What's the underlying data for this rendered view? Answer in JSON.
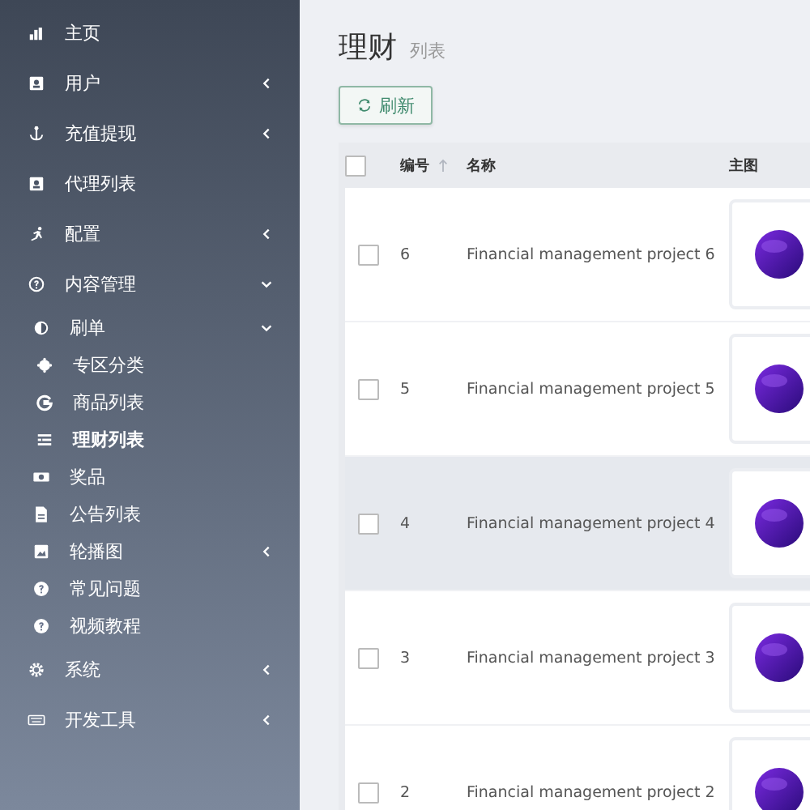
{
  "sidebar": {
    "items": [
      {
        "label": "主页",
        "selected": false
      },
      {
        "label": "用户",
        "expanded": false,
        "selected": false
      },
      {
        "label": "充值提现",
        "expanded": false,
        "selected": false
      },
      {
        "label": "代理列表",
        "selected": false
      },
      {
        "label": "配置",
        "expanded": false,
        "selected": false
      },
      {
        "label": "内容管理",
        "expanded": true,
        "selected": false,
        "children": [
          {
            "label": "刷单",
            "expanded": true,
            "selected": false,
            "children": [
              {
                "label": "专区分类",
                "selected": false
              },
              {
                "label": "商品列表",
                "selected": false
              },
              {
                "label": "理财列表",
                "selected": true
              }
            ]
          },
          {
            "label": "奖品",
            "selected": false
          },
          {
            "label": "公告列表",
            "selected": false
          },
          {
            "label": "轮播图",
            "expanded": false,
            "selected": false
          },
          {
            "label": "常见问题",
            "selected": false
          },
          {
            "label": "视频教程",
            "selected": false
          }
        ]
      },
      {
        "label": "系统",
        "expanded": false,
        "selected": false
      },
      {
        "label": "开发工具",
        "expanded": false,
        "selected": false
      }
    ]
  },
  "page": {
    "title": "理财",
    "subtitle": "列表"
  },
  "toolbar": {
    "refresh_button": "刷新"
  },
  "table": {
    "columns": [
      "编号",
      "名称",
      "主图"
    ],
    "select_all_checked": false,
    "rows": [
      {
        "id": "6",
        "name": "Financial management project 6",
        "checked": false,
        "highlighted": false
      },
      {
        "id": "5",
        "name": "Financial management project 5",
        "checked": false,
        "highlighted": false
      },
      {
        "id": "4",
        "name": "Financial management project 4",
        "checked": false,
        "highlighted": true
      },
      {
        "id": "3",
        "name": "Financial management project 3",
        "checked": false,
        "highlighted": false
      },
      {
        "id": "2",
        "name": "Financial management project 2",
        "checked": false,
        "highlighted": false
      }
    ]
  }
}
